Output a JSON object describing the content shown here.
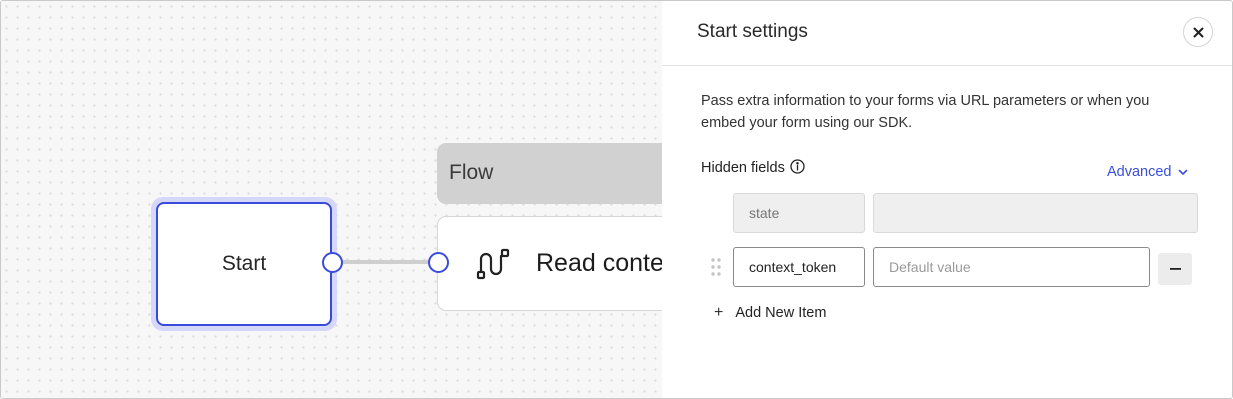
{
  "canvas": {
    "start_node": {
      "label": "Start"
    },
    "flow_group": {
      "label": "Flow"
    },
    "read_node": {
      "label": "Read conte",
      "icon": "flow-route-icon"
    }
  },
  "panel": {
    "title": "Start settings",
    "close_icon": "close-icon",
    "description": "Pass extra information to your forms via URL parameters or when you embed your form using our SDK.",
    "hidden_fields_label": "Hidden fields",
    "info_icon": "info-icon",
    "advanced_label": "Advanced",
    "rows": [
      {
        "name": "state",
        "value": ""
      },
      {
        "name": "context_token",
        "value_placeholder": "Default value"
      }
    ],
    "add_item_label": "Add New Item"
  },
  "colors": {
    "accent": "#3a4bdc",
    "link": "#3b4fd8",
    "node_halo": "#d6d8fb"
  }
}
